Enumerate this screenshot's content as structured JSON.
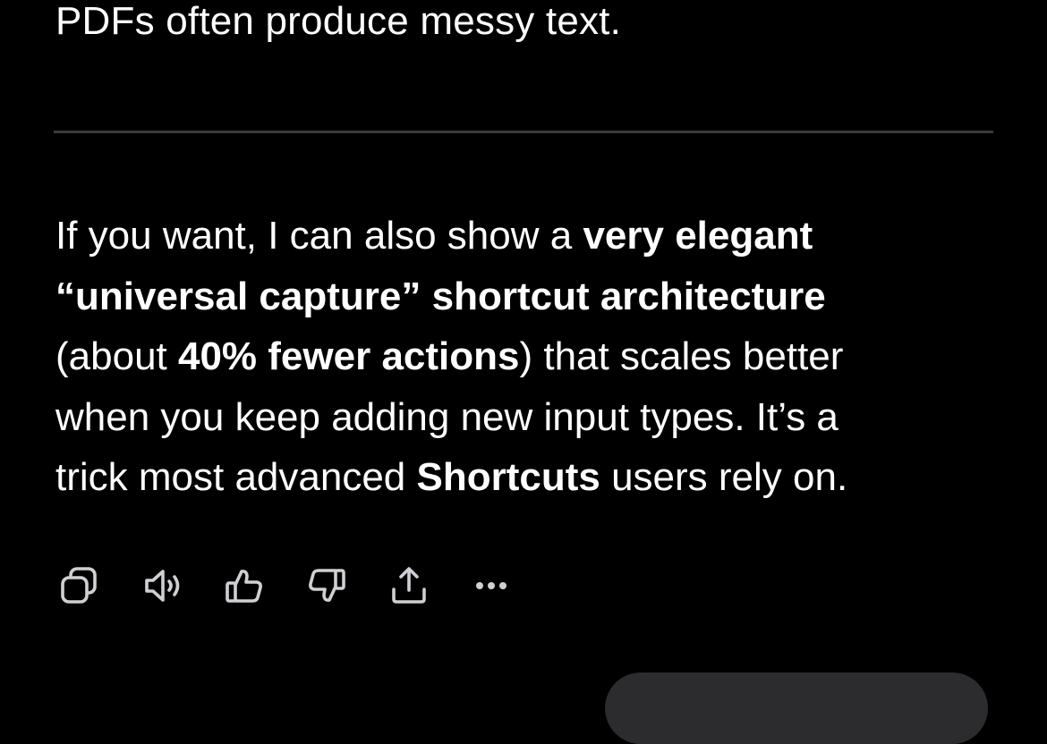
{
  "message": {
    "top_line": "PDFs often produce messy text.",
    "paragraph": {
      "row1_normal": "If you want, I can also show a ",
      "row1_bold": "very elegant",
      "row2_bold": "“universal capture” shortcut architecture",
      "row3_open": "(about ",
      "row3_bold": "40% fewer actions",
      "row3_rest": ") that scales better",
      "row4": "when you keep adding new input types. It’s a",
      "row5_normal": "trick most advanced ",
      "row5_bold": "Shortcuts",
      "row5_rest": " users rely on."
    }
  },
  "actions": [
    {
      "icon": "copy-icon"
    },
    {
      "icon": "speaker-icon"
    },
    {
      "icon": "thumbs-up-icon"
    },
    {
      "icon": "thumbs-down-icon"
    },
    {
      "icon": "share-icon"
    },
    {
      "icon": "more-icon"
    }
  ],
  "colors": {
    "background": "#000000",
    "text": "#ffffff",
    "icon": "#d0d0d4",
    "divider": "#3a3a3c",
    "pill": "#2c2c2e"
  }
}
